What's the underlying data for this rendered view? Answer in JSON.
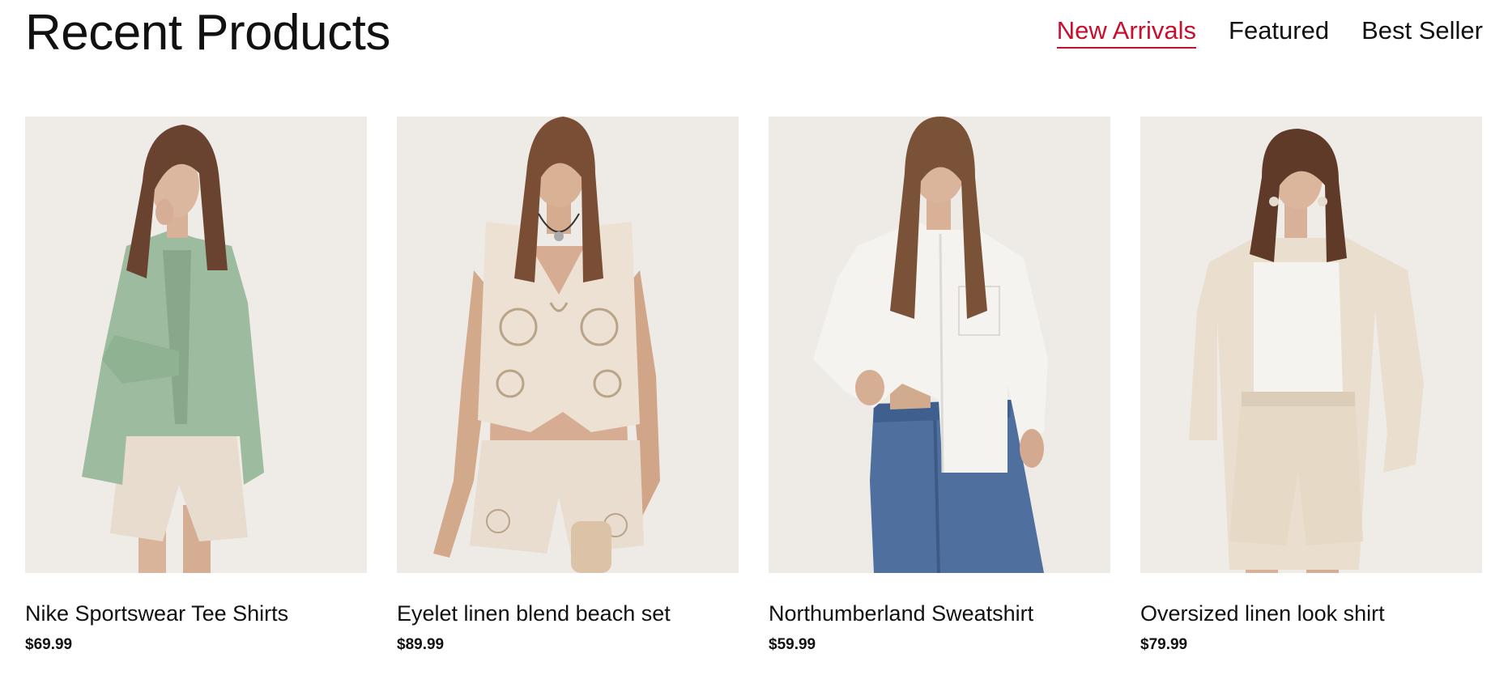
{
  "section": {
    "title": "Recent Products",
    "tabs": [
      {
        "label": "New Arrivals",
        "active": true
      },
      {
        "label": "Featured",
        "active": false
      },
      {
        "label": "Best Seller",
        "active": false
      }
    ]
  },
  "colors": {
    "accent": "#c8102e",
    "text": "#111111",
    "image_background": "#eeebe7"
  },
  "products": [
    {
      "name": "Nike Sportswear Tee Shirts",
      "price": "$69.99",
      "image_icon": "model-green-shirt-photo"
    },
    {
      "name": "Eyelet linen blend beach set",
      "price": "$89.99",
      "image_icon": "model-eyelet-set-photo"
    },
    {
      "name": "Northumberland Sweatshirt",
      "price": "$59.99",
      "image_icon": "model-white-shirt-jeans-photo"
    },
    {
      "name": "Oversized linen look shirt",
      "price": "$79.99",
      "image_icon": "model-linen-shirt-photo"
    }
  ]
}
